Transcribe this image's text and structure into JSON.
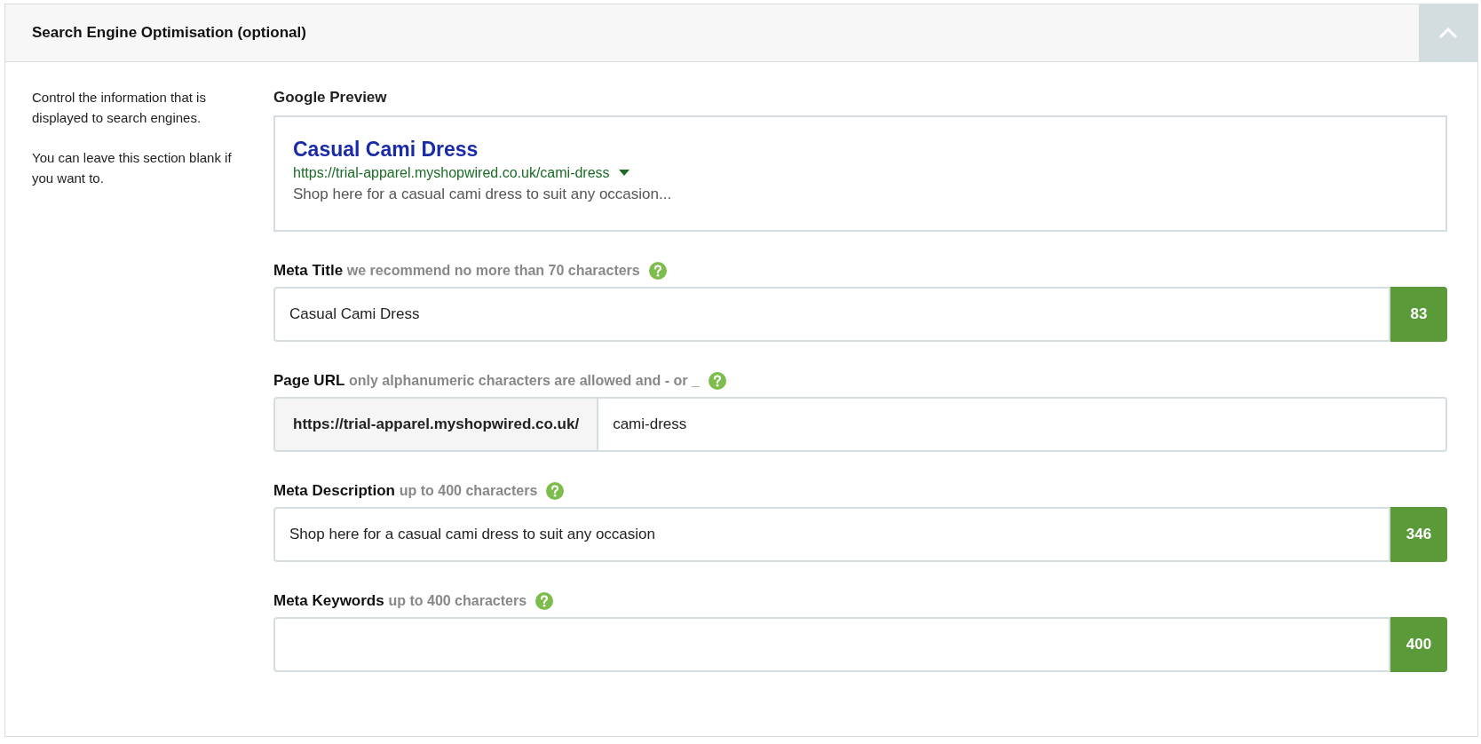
{
  "header": {
    "title": "Search Engine Optimisation (optional)",
    "expanded": true
  },
  "intro": [
    "Control the information that is displayed to search engines.",
    "You can leave this section blank if you want to."
  ],
  "preview": {
    "label": "Google Preview",
    "title": "Casual Cami Dress",
    "url": "https://trial-apparel.myshopwired.co.uk/cami-dress",
    "description": "Shop here for a casual cami dress to suit any occasion..."
  },
  "fields": [
    {
      "kind": "counter",
      "label": "Meta Title",
      "hint": "we recommend no more than 70 characters",
      "value": "Casual Cami Dress",
      "count": "83"
    },
    {
      "kind": "prefixed",
      "label": "Page URL",
      "hint": "only alphanumeric characters are allowed and - or _",
      "prefix": "https://trial-apparel.myshopwired.co.uk/",
      "value": "cami-dress"
    },
    {
      "kind": "counter",
      "label": "Meta Description",
      "hint": "up to 400 characters",
      "value": "Shop here for a casual cami dress to suit any occasion",
      "count": "346"
    },
    {
      "kind": "counter",
      "label": "Meta Keywords",
      "hint": "up to 400 characters",
      "count": "400"
    }
  ]
}
